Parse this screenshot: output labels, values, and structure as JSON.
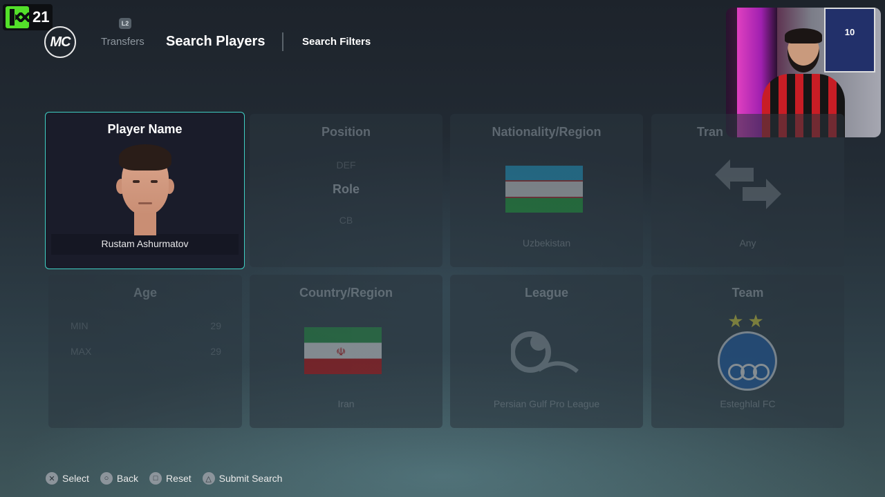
{
  "channel_badge": {
    "text": "21",
    "icon": "k-channel-logo"
  },
  "header": {
    "logo_text": "MC",
    "shoulder_hint": "L2",
    "nav_transfers": "Transfers",
    "page_title": "Search Players",
    "tab_filters": "Search Filters"
  },
  "webcam": {
    "jersey_number": "10"
  },
  "cards": {
    "player_name": {
      "title": "Player Name",
      "value": "Rustam Ashurmatov"
    },
    "position": {
      "title": "Position",
      "prev": "DEF",
      "current": "Role",
      "next": "CB"
    },
    "nationality": {
      "title": "Nationality/Region",
      "value": "Uzbekistan",
      "flag": "uzbekistan-flag"
    },
    "transfer": {
      "title": "Tran",
      "value": "Any",
      "icon": "transfer-arrows-icon"
    },
    "age": {
      "title": "Age",
      "min_label": "MIN",
      "min_value": "29",
      "max_label": "MAX",
      "max_value": "29"
    },
    "country": {
      "title": "Country/Region",
      "value": "Iran",
      "flag": "iran-flag"
    },
    "league": {
      "title": "League",
      "value": "Persian Gulf Pro League",
      "icon": "persian-gulf-league-logo"
    },
    "team": {
      "title": "Team",
      "value": "Esteghlal FC",
      "stars": "★★",
      "icon": "esteghlal-crest"
    }
  },
  "footer": {
    "select": {
      "icon": "✕",
      "label": "Select"
    },
    "back": {
      "icon": "○",
      "label": "Back"
    },
    "reset": {
      "icon": "□",
      "label": "Reset"
    },
    "submit": {
      "icon": "△",
      "label": "Submit Search"
    }
  },
  "colors": {
    "accent": "#3fd0c4",
    "background": "#232c35"
  }
}
